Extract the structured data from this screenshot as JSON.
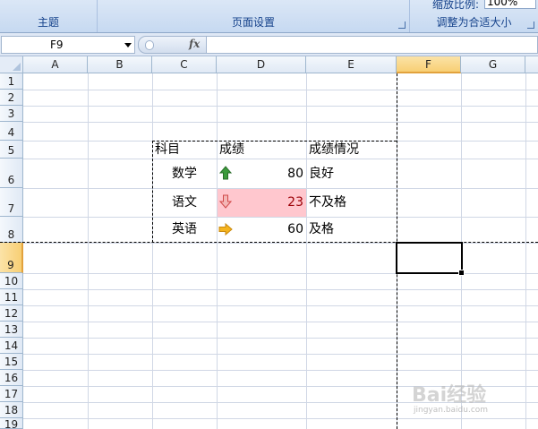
{
  "ribbon": {
    "groups": [
      "主题",
      "页面设置",
      "调整为合适大小"
    ],
    "zoom_label": "缩放比例:",
    "zoom_value": "100%"
  },
  "formula_bar": {
    "name_box": "F9",
    "fx_label": "fx",
    "formula": ""
  },
  "columns": [
    "A",
    "B",
    "C",
    "D",
    "E",
    "F",
    "G"
  ],
  "rows": [
    "1",
    "2",
    "3",
    "4",
    "5",
    "6",
    "7",
    "8",
    "9",
    "10",
    "11",
    "12",
    "13",
    "14",
    "15",
    "16",
    "17",
    "18",
    "19"
  ],
  "active_column": "F",
  "active_row": "9",
  "table": {
    "header": {
      "subject": "科目",
      "score": "成绩",
      "status": "成绩情况"
    },
    "rows": [
      {
        "subject": "数学",
        "score": "80",
        "status": "良好",
        "icon": "green-up-arrow-icon",
        "highlight": false
      },
      {
        "subject": "语文",
        "score": "23",
        "status": "不及格",
        "icon": "red-down-arrow-icon",
        "highlight": true
      },
      {
        "subject": "英语",
        "score": "60",
        "status": "及格",
        "icon": "yellow-right-arrow-icon",
        "highlight": false
      }
    ]
  },
  "colors": {
    "up_arrow": "#3c9a3c",
    "down_arrow": "#e05a5a",
    "right_arrow": "#f5b41e",
    "low_score_fill": "#ffc7ce",
    "low_score_text": "#9c0006"
  },
  "watermark": {
    "main": "Bai经验",
    "sub": "jingyan.baidu.com"
  }
}
